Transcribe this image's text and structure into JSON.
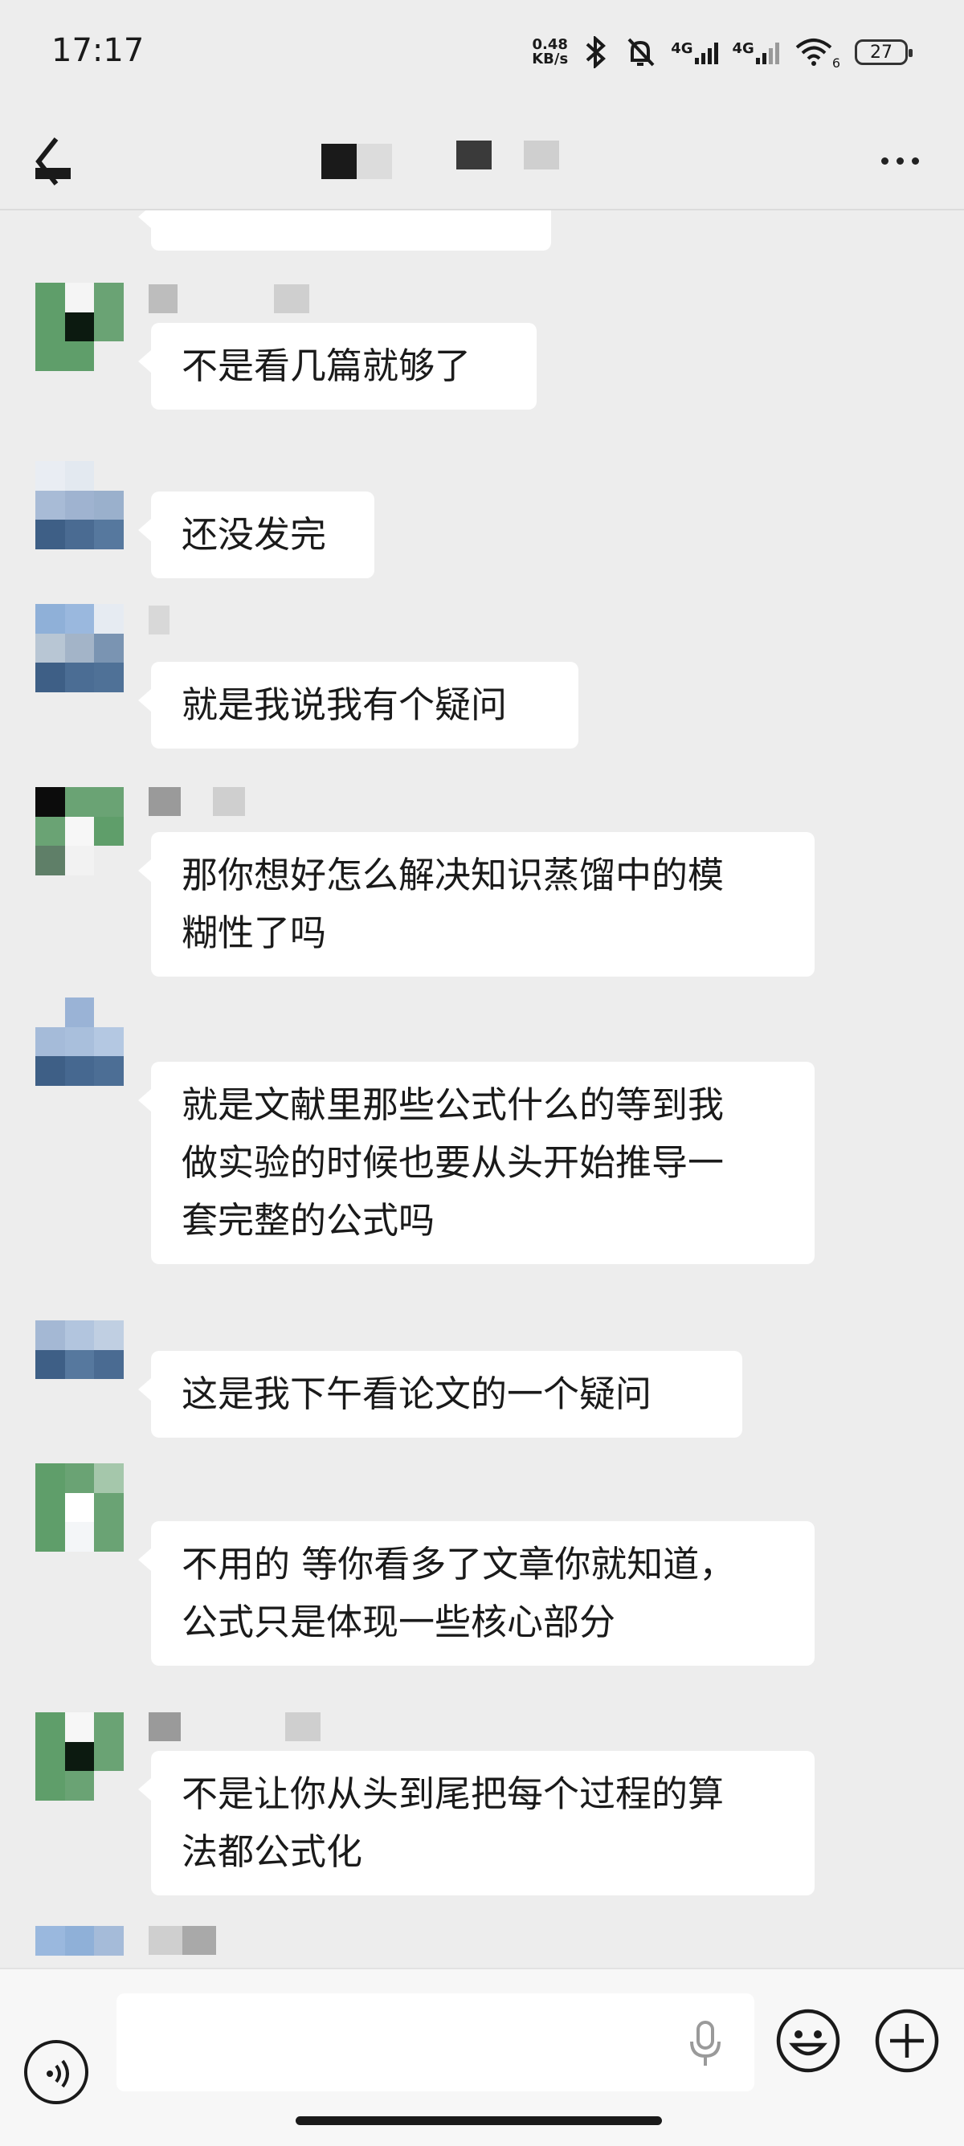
{
  "status_bar": {
    "time": "17:17",
    "net_speed_value": "0.48",
    "net_speed_unit": "KB/s",
    "sim1_label": "4G",
    "sim2_label": "4G",
    "wifi_badge": "6",
    "battery_level": "27",
    "icons": [
      "bluetooth-icon",
      "mute-bell-icon",
      "signal-icon",
      "wifi-icon",
      "battery-icon"
    ]
  },
  "nav": {
    "back_icon": "back-arrow-icon",
    "more_icon": "more-dots-icon"
  },
  "messages": [
    {
      "sender_side": "left",
      "text": "不是看几篇就够了"
    },
    {
      "sender_side": "left",
      "text": "还没发完"
    },
    {
      "sender_side": "left",
      "text": "就是我说我有个疑问"
    },
    {
      "sender_side": "left",
      "text": "那你想好怎么解决知识蒸馏中的模\n糊性了吗"
    },
    {
      "sender_side": "left",
      "text": "就是文献里那些公式什么的等到我\n做实验的时候也要从头开始推导一\n套完整的公式吗"
    },
    {
      "sender_side": "left",
      "text": "这是我下午看论文的一个疑问"
    },
    {
      "sender_side": "left",
      "text": "不用的 等你看多了文章你就知道，\n公式只是体现一些核心部分"
    },
    {
      "sender_side": "left",
      "text": "不是让你从头到尾把每个过程的算\n法都公式化"
    }
  ],
  "input_bar": {
    "text_value": "",
    "icons": [
      "voice-icon",
      "microphone-icon",
      "emoji-icon",
      "plus-icon"
    ]
  },
  "colors": {
    "background": "#ededed",
    "bubble": "#ffffff",
    "text": "#1a1a1a"
  }
}
